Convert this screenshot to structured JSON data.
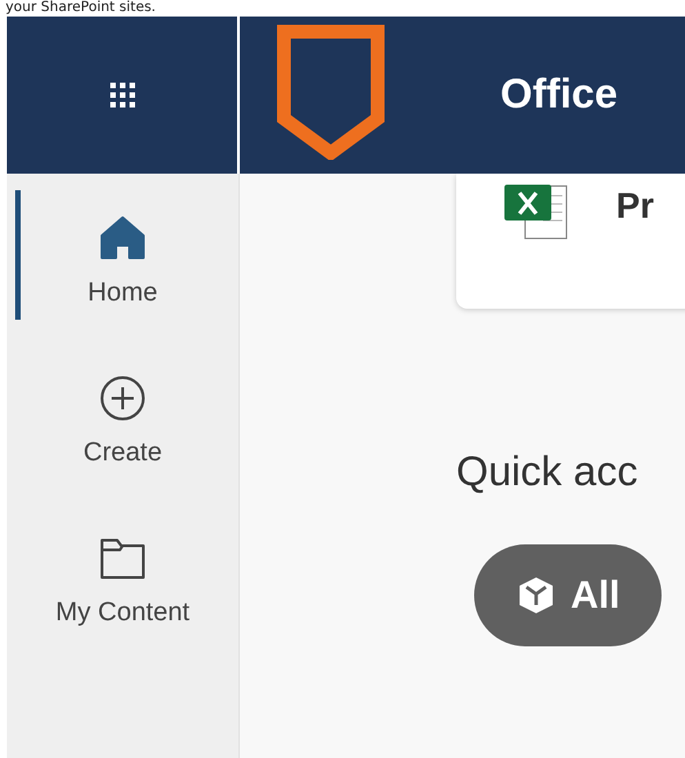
{
  "top_text": "your SharePoint sites.",
  "header": {
    "app_name": "Office"
  },
  "sidebar": {
    "items": [
      {
        "label": "Home",
        "kind": "home",
        "selected": true
      },
      {
        "label": "Create",
        "kind": "create",
        "selected": false
      },
      {
        "label": "My Content",
        "kind": "folder",
        "selected": false
      }
    ]
  },
  "recent_card": {
    "file_name": "Pr"
  },
  "quick_access": {
    "heading": "Quick acc",
    "filters": [
      {
        "label": "All",
        "selected": true
      }
    ]
  }
}
